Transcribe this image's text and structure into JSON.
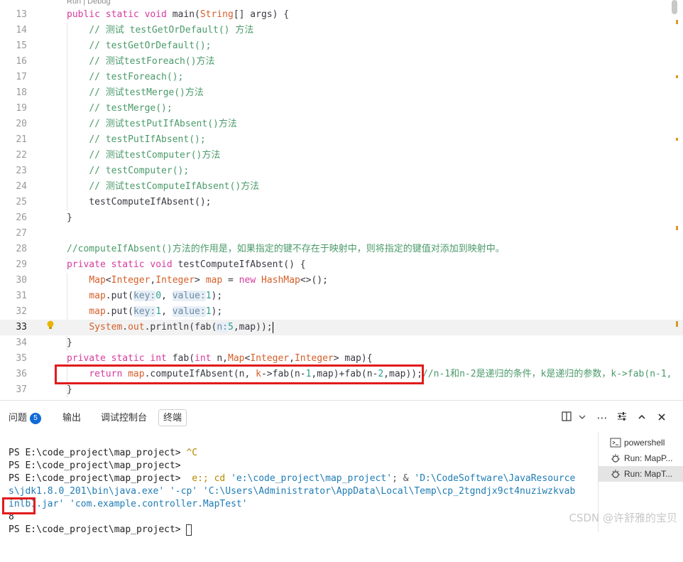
{
  "editor": {
    "codelens": "Run | Debug",
    "lines": [
      13,
      14,
      15,
      16,
      17,
      18,
      19,
      20,
      21,
      22,
      23,
      24,
      25,
      26,
      27,
      28,
      29,
      30,
      31,
      32,
      33,
      34,
      35,
      36,
      37
    ],
    "current_line": 33,
    "comment_tail_36": "//n-1和n-2是递归的条件，k是递归的参数，k->fab(n-1,"
  },
  "panel": {
    "tabs": [
      {
        "label": "问题",
        "badge": "5"
      },
      {
        "label": "输出"
      },
      {
        "label": "调试控制台"
      },
      {
        "label": "终端"
      }
    ],
    "active_tab": "终端",
    "terminal": {
      "line1_prompt": "PS E:\\code_project\\map_project> ",
      "line1_input": "^C",
      "line2": "PS E:\\code_project\\map_project>",
      "line3_prompt": "PS E:\\code_project\\map_project> ",
      "line3_cmd": " e:; cd ",
      "line3_path": "'e:\\code_project\\map_project'",
      "line3_amp": "; & ",
      "line3_java": "'D:\\CodeSoftware\\JavaResource",
      "line4": "s\\jdk1.8.0_201\\bin\\java.exe' '-cp' 'C:\\Users\\Administrator\\AppData\\Local\\Temp\\cp_2tgndjx9ct4nuziwzkvab",
      "line5": "inlb1.jar' 'com.example.controller.MapTest'",
      "output": "8",
      "line7_prompt": "PS E:\\code_project\\map_project> "
    },
    "sessions": [
      {
        "label": "powershell",
        "icon": "terminal-icon"
      },
      {
        "label": "Run: MapP...",
        "icon": "debug-gear-icon"
      },
      {
        "label": "Run: MapT...",
        "icon": "debug-gear-icon"
      }
    ],
    "selected_session": 2
  },
  "watermark": "CSDN @许舒雅的宝贝",
  "colors": {
    "keyword": "#d73a9e",
    "comment": "#4b9a6a",
    "type": "#d45f2a",
    "highlight_box": "#e11b1b",
    "badge": "#0f6ad8"
  }
}
